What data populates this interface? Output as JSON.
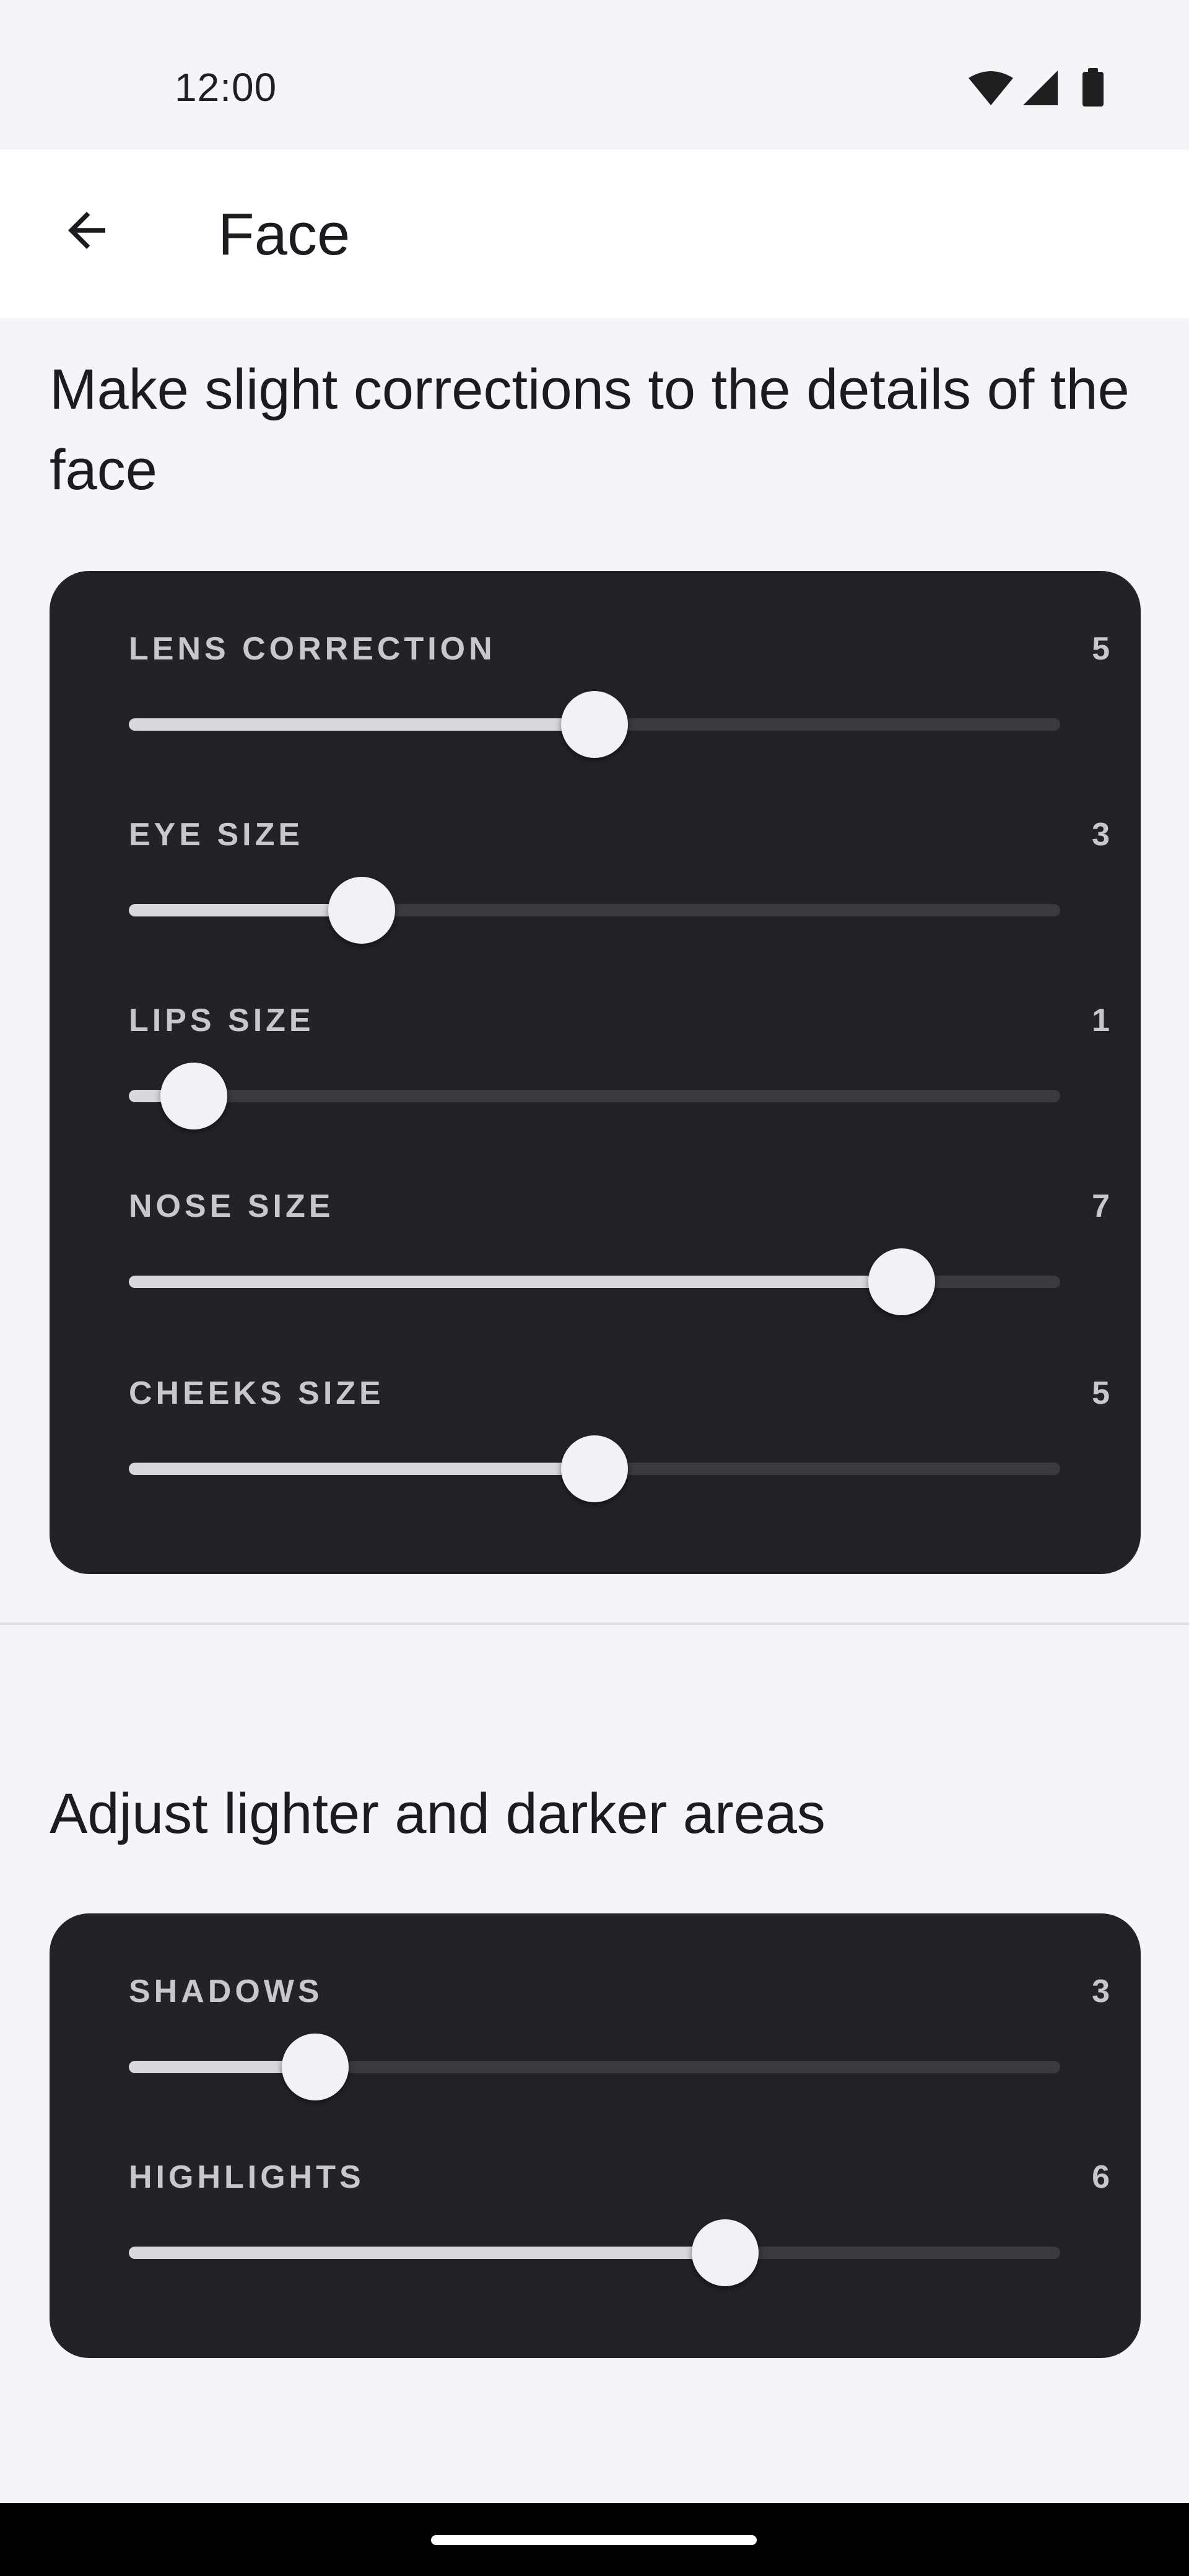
{
  "status_bar": {
    "time": "12:00",
    "icons": [
      "wifi-icon",
      "cellular-signal-icon",
      "battery-icon"
    ]
  },
  "app_bar": {
    "back_icon": "arrow-left-icon",
    "title": "Face"
  },
  "sections": [
    {
      "heading": "Make slight corrections to the details of the face",
      "sliders": [
        {
          "label": "LENS CORRECTION",
          "value": "5",
          "fraction": 0.5
        },
        {
          "label": "EYE SIZE",
          "value": "3",
          "fraction": 0.25
        },
        {
          "label": "LIPS SIZE",
          "value": "1",
          "fraction": 0.07
        },
        {
          "label": "NOSE SIZE",
          "value": "7",
          "fraction": 0.83
        },
        {
          "label": "CHEEKS SIZE",
          "value": "5",
          "fraction": 0.5
        }
      ]
    },
    {
      "heading": "Adjust lighter and darker areas",
      "sliders": [
        {
          "label": "SHADOWS",
          "value": "3",
          "fraction": 0.2
        },
        {
          "label": "HIGHLIGHTS",
          "value": "6",
          "fraction": 0.64
        }
      ]
    }
  ],
  "colors": {
    "background": "#f5f4f9",
    "card": "#232225",
    "track_active": "#d8d7db",
    "track_inactive": "#3a393c",
    "thumb": "#f2f2f5"
  }
}
